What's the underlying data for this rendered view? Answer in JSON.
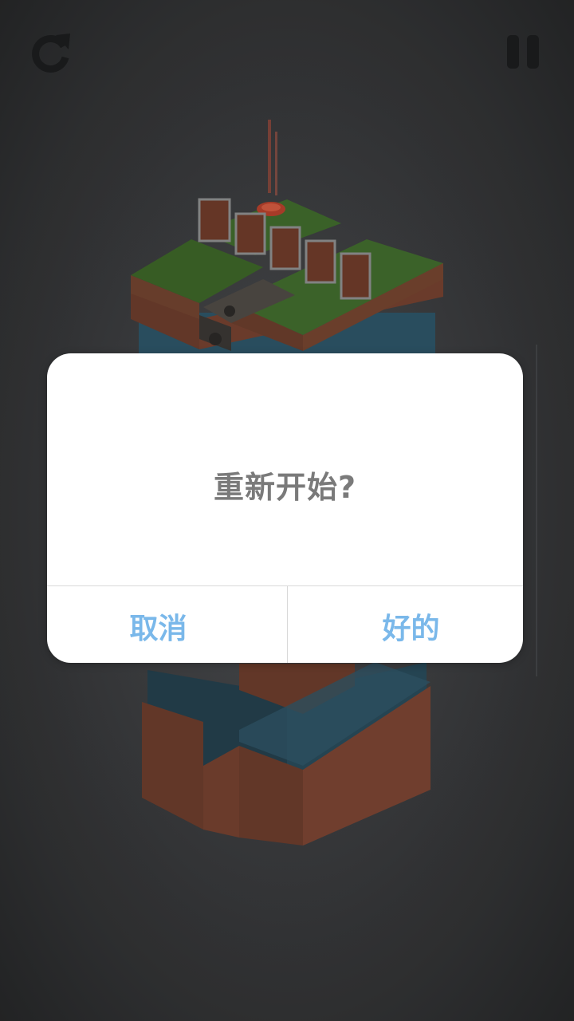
{
  "game": {
    "controls": {
      "restart_icon": "restart-icon",
      "pause_icon": "pause-icon"
    }
  },
  "dialog": {
    "message": "重新开始?",
    "cancel_label": "取消",
    "ok_label": "好的"
  },
  "colors": {
    "background": "#38393b",
    "dialog_bg": "#ffffff",
    "message_text": "#7a7a7a",
    "button_text": "#7ab8ea",
    "grass": "#3f6a2c",
    "brick": "#7a4a36",
    "water": "#3a6f8c",
    "icon": "#1e1f20"
  }
}
